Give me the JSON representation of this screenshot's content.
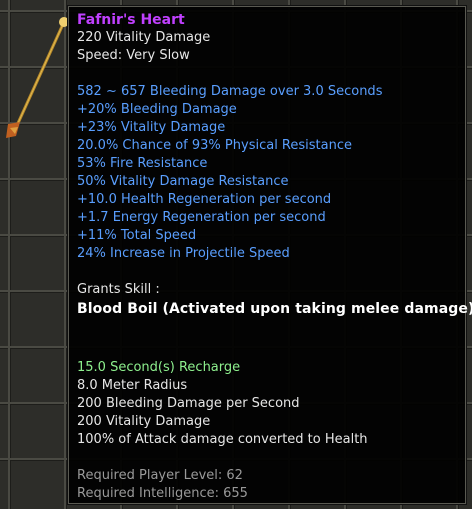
{
  "item": {
    "name": "Fafnir's Heart",
    "base_damage": "220 Vitality Damage",
    "speed": "Speed: Very Slow"
  },
  "modifiers": [
    "582 ~ 657 Bleeding Damage over 3.0 Seconds",
    "+20% Bleeding Damage",
    "+23% Vitality Damage",
    "20.0% Chance of 93% Physical Resistance",
    "53% Fire Resistance",
    "50% Vitality Damage Resistance",
    "+10.0 Health Regeneration per second",
    "+1.7 Energy Regeneration per second",
    "+11% Total Speed",
    "24% Increase in Projectile Speed"
  ],
  "skill": {
    "grants_label": "Grants Skill :",
    "name": "Blood Boil (Activated upon taking melee damage)",
    "recharge": "15.0 Second(s) Recharge",
    "details": [
      "8.0 Meter Radius",
      "200 Bleeding Damage per Second",
      "200 Vitality Damage",
      "100% of Attack damage converted to Health"
    ]
  },
  "requirements": [
    "Required Player Level: 62",
    "Required Intelligence: 655"
  ],
  "colors": {
    "item_name": "#c040ff",
    "modifier": "#5a9fff",
    "recharge": "#8ef08e",
    "requirement": "#9a9a9a"
  }
}
